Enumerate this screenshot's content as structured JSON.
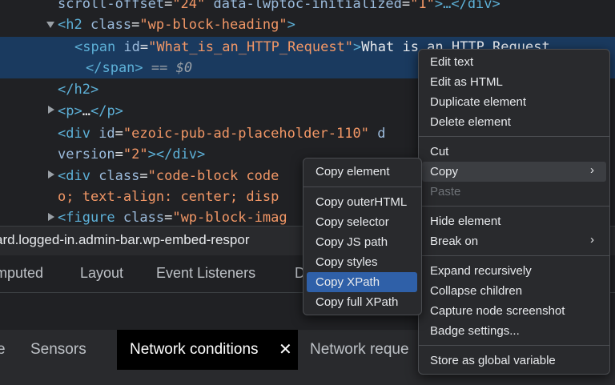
{
  "dom": {
    "l1": {
      "a": "scroll-offset",
      "b": "=",
      "c": "\"24\"",
      "d": " data-lwptoc-initialized",
      "e": "=",
      "f": "\"1\"",
      "g": ">…</div>"
    },
    "l2": {
      "a": "<h2 ",
      "b": "class",
      "c": "=",
      "d": "\"wp-block-heading\"",
      "e": ">"
    },
    "l3": {
      "a": "<span ",
      "b": "id",
      "c": "=",
      "d": "\"What_is_an_HTTP_Request\"",
      "e": ">",
      "f": "What is an HTTP Request"
    },
    "l4": {
      "a": "</span>",
      "b": " == $0"
    },
    "l5": {
      "a": "</h2>"
    },
    "l6": {
      "a": "<p>",
      "b": "…",
      "c": "</p>"
    },
    "l7": {
      "a": "<div ",
      "b": "id",
      "c": "=",
      "d": "\"ezoic-pub-ad-placeholder-110\"",
      "e": " d"
    },
    "l8": {
      "a": "version",
      "b": "=",
      "c": "\"2\"",
      "d": "></div>"
    },
    "l9": {
      "a": "<div ",
      "b": "class",
      "c": "=",
      "d": "\"code-block code",
      "e": ""
    },
    "l10": {
      "a": "o; text-align: center; disp"
    },
    "l11": {
      "a": "<figure ",
      "b": "class",
      "c": "=",
      "d": "\"wp-block-imag"
    }
  },
  "breadcrumb": "ard.logged-in.admin-bar.wp-embed-respor",
  "subtabs": [
    "mputed",
    "Layout",
    "Event Listeners",
    "D"
  ],
  "drawer": {
    "tab_partial": "e",
    "sensors": "Sensors",
    "network_conditions": "Network conditions",
    "close_glyph": "✕",
    "network_requests": "Network reque"
  },
  "context_menu": {
    "items": [
      "Edit text",
      "Edit as HTML",
      "Duplicate element",
      "Delete element",
      "Cut",
      "Copy",
      "Paste",
      "Hide element",
      "Break on",
      "Expand recursively",
      "Collapse children",
      "Capture node screenshot",
      "Badge settings...",
      "Store as global variable"
    ],
    "submenu_arrow": "›"
  },
  "copy_submenu": {
    "items": [
      "Copy element",
      "Copy outerHTML",
      "Copy selector",
      "Copy JS path",
      "Copy styles",
      "Copy XPath",
      "Copy full XPath"
    ],
    "selected": "Copy XPath"
  },
  "colors": {
    "tag": "#5db0d7",
    "attr": "#9bbbdc",
    "value": "#f29766",
    "selection": "#2f60a8",
    "row_highlight": "#1a3a5f"
  }
}
